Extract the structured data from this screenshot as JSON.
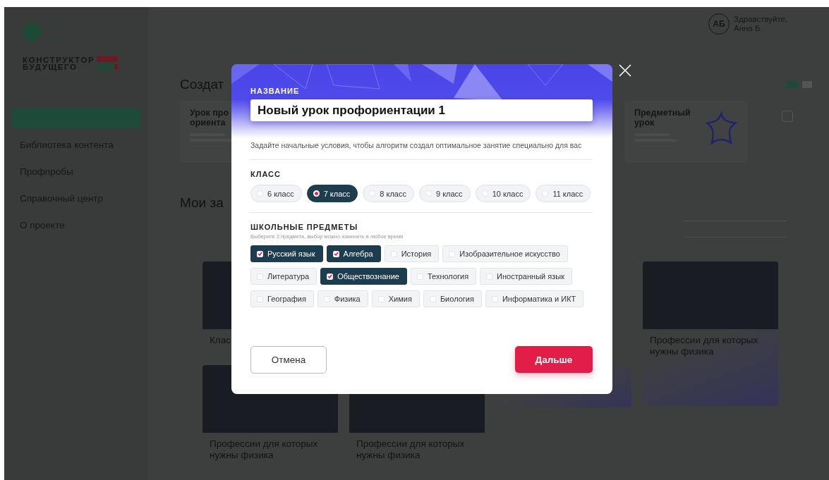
{
  "sidebar": {
    "logo": {
      "line_1": "КОНСТРУКТОР",
      "line_2": "БУДУЩЕГО"
    },
    "items": [
      {
        "selected": true
      },
      {
        "label": "Библиотека контента",
        "selected": false
      },
      {
        "label": "Профпробы",
        "selected": false
      },
      {
        "label": "Справочный центр",
        "selected": false
      },
      {
        "label": "О проекте",
        "selected": false
      }
    ]
  },
  "header": {
    "avatar": "АБ",
    "greeting": "Здравствуйте, Анна Б."
  },
  "create_section": {
    "title": "Создат",
    "cards": [
      {
        "title": "Урок про ориента",
        "kind": "plain"
      },
      {
        "title": "Предметный урок",
        "kind": "illustrated"
      }
    ]
  },
  "my_lessons": {
    "title": "Мои за",
    "cards": [
      {
        "title": "Клас"
      },
      {
        "title": "Профессии для которых нужны физика"
      },
      {
        "title": "Профессии для которых нужны физика"
      },
      {
        "title": "Профессии для которых нужны физика"
      }
    ]
  },
  "modal": {
    "name_label": "НАЗВАНИЕ",
    "name_value": "Новый урок профориентации 1",
    "description": "Задайте начальные условия, чтобы алгоритм создал оптимальное занятие специально для вас",
    "grade_label": "КЛАСС",
    "grades": [
      {
        "label": "6 класс",
        "selected": false
      },
      {
        "label": "7 класс",
        "selected": true
      },
      {
        "label": "8 класс",
        "selected": false
      },
      {
        "label": "9 класс",
        "selected": false
      },
      {
        "label": "10 класс",
        "selected": false
      },
      {
        "label": "11 класс",
        "selected": false
      }
    ],
    "subjects_label": "ШКОЛЬНЫЕ ПРЕДМЕТЫ",
    "subjects_hint": "Выберите 3 предмета, выбор можно изменить в любое время",
    "subject_rows": [
      [
        {
          "label": "Русский язык",
          "checked": true
        },
        {
          "label": "Алгебра",
          "checked": true
        },
        {
          "label": "История",
          "checked": false
        },
        {
          "label": "Изобразительное искусство",
          "checked": false
        }
      ],
      [
        {
          "label": "Литература",
          "checked": false
        },
        {
          "label": "Обществознание",
          "checked": true
        },
        {
          "label": "Технология",
          "checked": false
        },
        {
          "label": "Иностранный язык",
          "checked": false
        }
      ],
      [
        {
          "label": "География",
          "checked": false
        },
        {
          "label": "Физика",
          "checked": false
        },
        {
          "label": "Химия",
          "checked": false
        },
        {
          "label": "Биология",
          "checked": false
        },
        {
          "label": "Информатика и ИКТ",
          "checked": false
        }
      ]
    ],
    "cancel": "Отмена",
    "next": "Дальше"
  }
}
